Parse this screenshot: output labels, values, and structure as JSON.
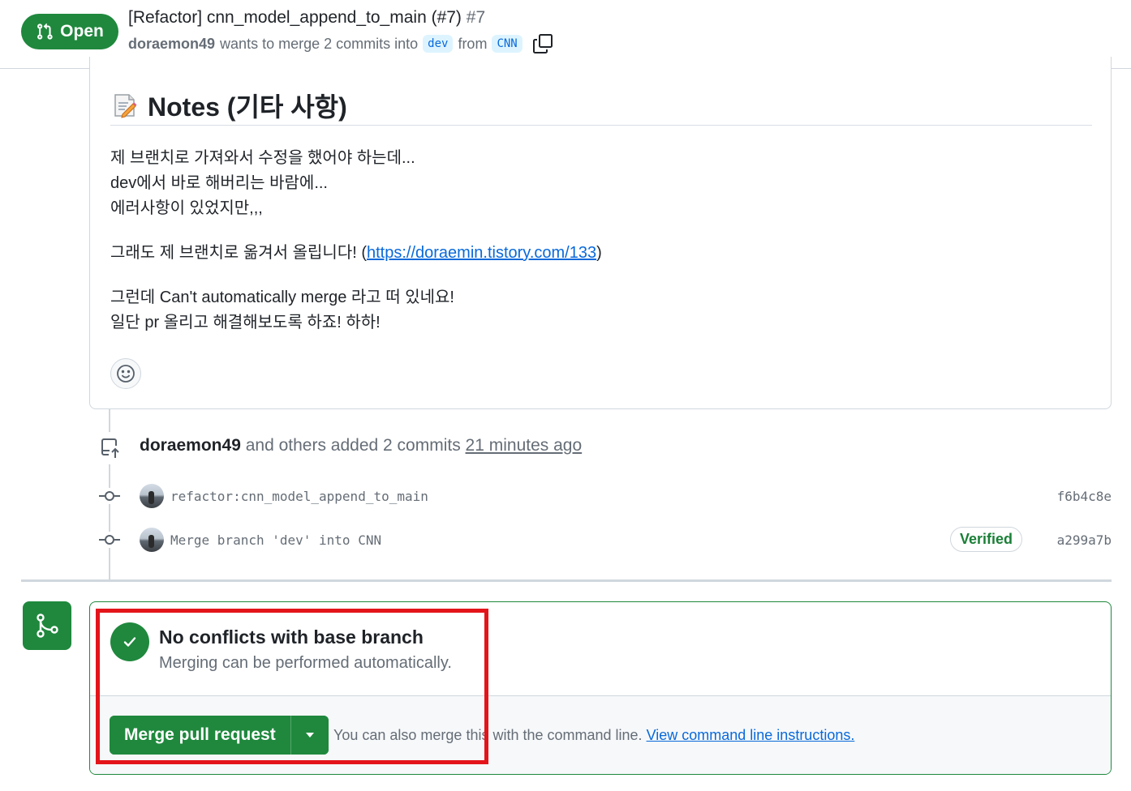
{
  "header": {
    "state_label": "Open",
    "title": "[Refactor] cnn_model_append_to_main (#7)",
    "number": "#7",
    "author": "doraemon49",
    "merge_text": "wants to merge 2 commits into",
    "base_branch": "dev",
    "from_text": "from",
    "head_branch": "CNN"
  },
  "comment": {
    "heading": "Notes (기타 사항)",
    "lines_1": [
      "제 브랜치로 가져와서 수정을 했어야 하는데...",
      "dev에서 바로 해버리는 바람에...",
      "에러사항이 있었지만,,,"
    ],
    "line_2_prefix": "그래도 제 브랜치로 옮겨서 올립니다! (",
    "line_2_link": "https://doraemin.tistory.com/133",
    "line_2_suffix": ")",
    "lines_3": [
      "그런데 Can't automatically merge 라고 떠 있네요!",
      "일단 pr 올리고 해결해보도록 하죠! 하하!"
    ]
  },
  "timeline": {
    "push_author": "doraemon49",
    "push_text": "and others added 2 commits",
    "push_time": "21 minutes ago",
    "commits": [
      {
        "message": "refactor:cnn_model_append_to_main",
        "sha": "f6b4c8e",
        "verified": ""
      },
      {
        "message": "Merge branch 'dev' into CNN",
        "sha": "a299a7b",
        "verified": "Verified"
      }
    ]
  },
  "merge": {
    "status_title": "No conflicts with base branch",
    "status_sub": "Merging can be performed automatically.",
    "button_label": "Merge pull request",
    "hint_text": "You can also merge this with the command line.",
    "hint_link": "View command line instructions."
  },
  "colors": {
    "success": "#1f883d",
    "link": "#0969da",
    "highlight": "#e3151a",
    "muted": "#656d76"
  }
}
